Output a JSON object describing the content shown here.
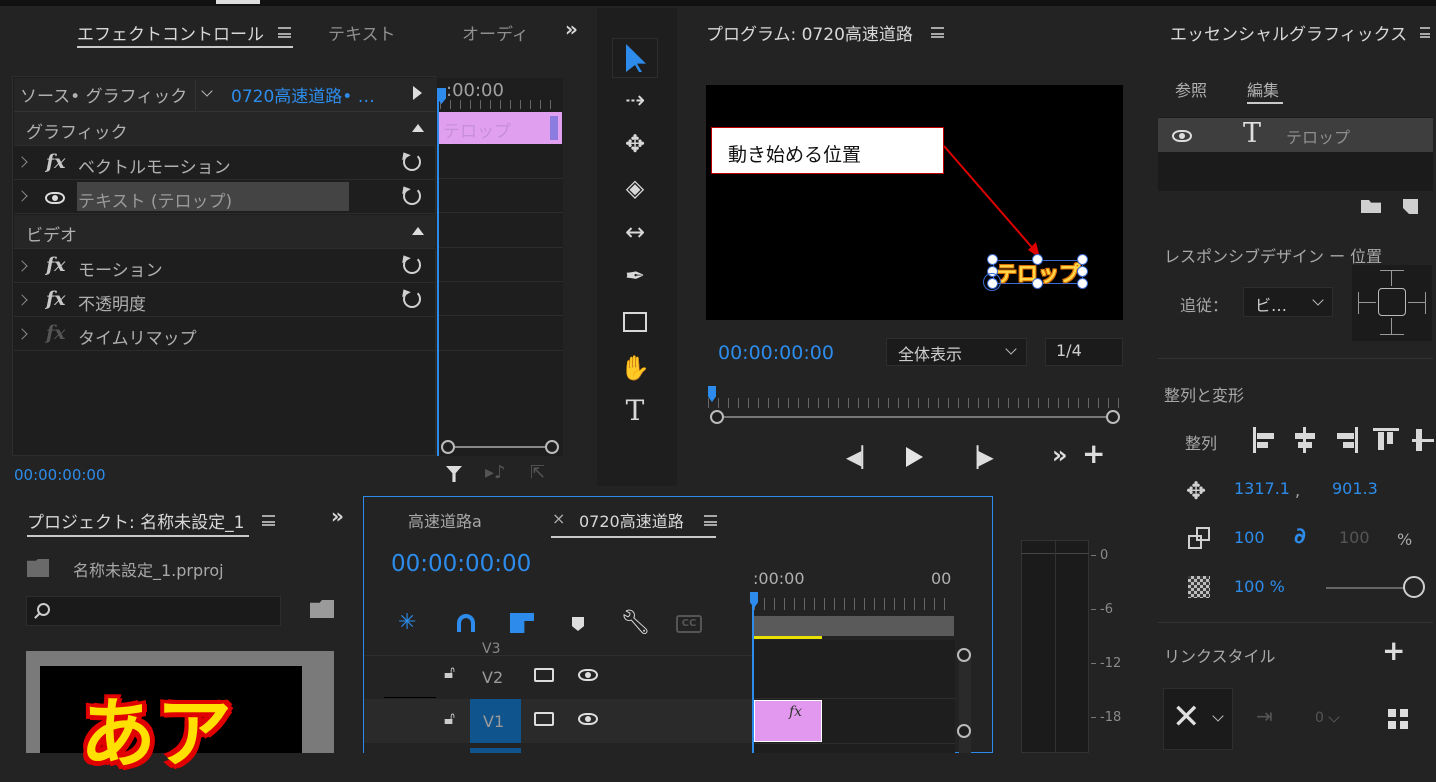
{
  "effect_controls": {
    "tabs": [
      "エフェクトコントロール",
      "テキスト",
      "オーディ"
    ],
    "source_label": "ソース• グラフィック",
    "clip_name": "0720高速道路• …",
    "timeline_time": ":00:00",
    "clip_label": "テロップ",
    "sections": {
      "graphic": "グラフィック",
      "video": "ビデオ"
    },
    "rows": {
      "vector_motion": "ベクトルモーション",
      "text_layer": "テキスト (テロップ)",
      "motion": "モーション",
      "opacity": "不透明度",
      "time_remap": "タイムリマップ"
    },
    "fx_symbol": "fx",
    "timecode": "00:00:00:00"
  },
  "program": {
    "title": "プログラム: 0720高速道路",
    "annotation": "動き始める位置",
    "telop_text": "テロップ",
    "timecode": "00:00:00:00",
    "zoom": "全体表示",
    "resolution": "1/4"
  },
  "essential_graphics": {
    "title": "エッセンシャルグラフィックス",
    "tabs": [
      "参照",
      "編集"
    ],
    "layer_name": "テロップ",
    "responsive_label": "レスポンシブデザイン ー 位置",
    "follow_label": "追従：",
    "follow_value": "ビ…",
    "align_section": "整列と変形",
    "align_label": "整列",
    "position_x": "1317.1",
    "comma": ",",
    "position_y": "901.3",
    "scale": "100",
    "scale_linked": "100",
    "percent": "%",
    "opacity": "100 %",
    "link_style": "リンクスタイル",
    "link_count": "0"
  },
  "project": {
    "title": "プロジェクト: 名称未設定_1",
    "file": "名称未設定_1.prproj",
    "thumb_text": "あア"
  },
  "timeline": {
    "tabs": [
      "高速道路a",
      "0720高速道路"
    ],
    "timecode": "00:00:00:00",
    "ruler_start": ":00:00",
    "ruler_end": "00",
    "tracks": [
      "V2",
      "V1"
    ],
    "track_v3": "V3",
    "cc_label": "CC",
    "fx_symbol": "fx"
  },
  "meter": {
    "scale": [
      "0",
      "-6",
      "-12",
      "-18"
    ]
  }
}
